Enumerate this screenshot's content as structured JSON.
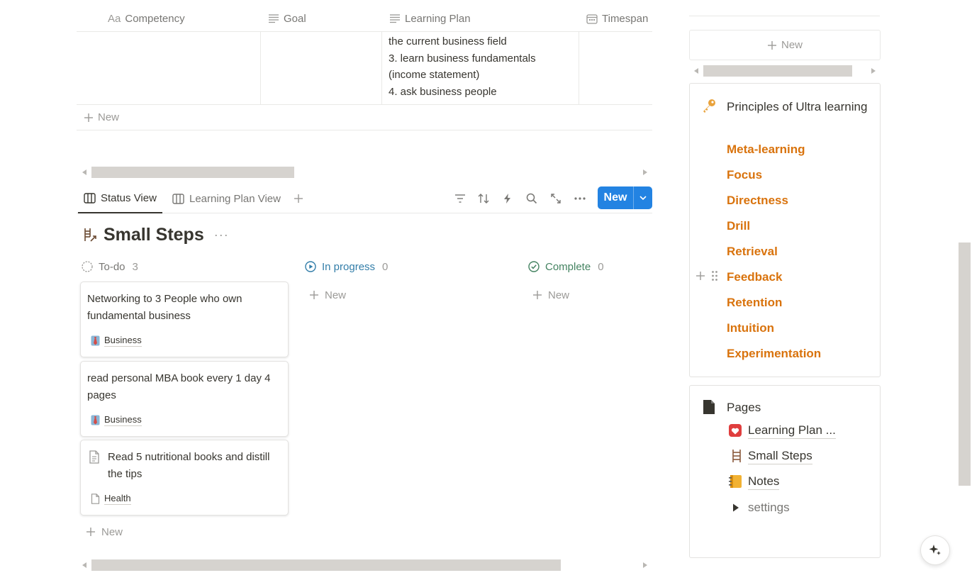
{
  "table": {
    "columns": [
      {
        "label": "Competency",
        "icon": "text-type-icon"
      },
      {
        "label": "Goal",
        "icon": "lines-icon"
      },
      {
        "label": "Learning Plan",
        "icon": "lines-icon"
      },
      {
        "label": "Timespan",
        "icon": "calendar-icon"
      }
    ],
    "plan_lines": [
      "the current business field",
      "3. learn business fundamentals",
      "(income statement)",
      "4. ask business people"
    ],
    "new_label": "New",
    "text_type_glyph": "Aa"
  },
  "views": {
    "tabs": [
      {
        "label": "Status View",
        "active": true
      },
      {
        "label": "Learning Plan View",
        "active": false
      }
    ],
    "new_button_label": "New",
    "accent": "#2383e2"
  },
  "board": {
    "title": "Small Steps",
    "more_label": "···",
    "columns": [
      {
        "label": "To-do",
        "count": "3",
        "color": "#787774"
      },
      {
        "label": "In progress",
        "count": "0",
        "color": "#337ea9"
      },
      {
        "label": "Complete",
        "count": "0",
        "color": "#448361"
      }
    ],
    "new_label": "New",
    "cards": [
      {
        "title": "Networking to 3 People who own fundamental business",
        "tag": "Business"
      },
      {
        "title": "read personal MBA book every 1 day 4 pages",
        "tag": "Business"
      },
      {
        "title": "Read 5 nutritional books and distill the tips",
        "tag": "Health"
      }
    ]
  },
  "sidebar": {
    "new_label": "New",
    "principles": {
      "title": "Principles of Ultra learning",
      "items": [
        "Meta-learning",
        "Focus",
        "Directness",
        "Drill",
        "Retrieval",
        "Feedback",
        "Retention",
        "Intuition",
        "Experimentation"
      ],
      "color": "#d9730d"
    },
    "pages": {
      "title": "Pages",
      "links": [
        {
          "label": "Learning Plan ...",
          "icon": "heart-icon"
        },
        {
          "label": "Small Steps",
          "icon": "ladder-icon"
        },
        {
          "label": "Notes",
          "icon": "notebook-icon"
        }
      ],
      "toggle": "settings"
    }
  }
}
